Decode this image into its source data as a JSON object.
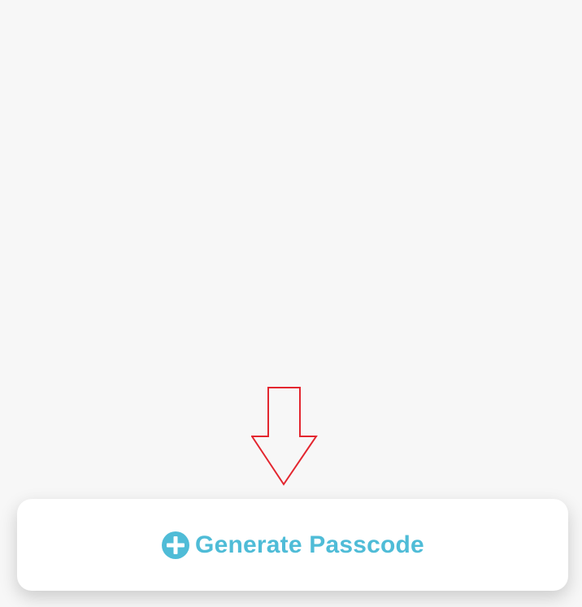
{
  "actions": {
    "generate_passcode": {
      "label": "Generate Passcode",
      "icon": "plus-circle-icon"
    }
  },
  "annotation": {
    "icon": "down-arrow-icon"
  },
  "colors": {
    "background": "#f7f7f7",
    "card": "#ffffff",
    "accent": "#4fbcd7",
    "annotation": "#e3262f"
  }
}
